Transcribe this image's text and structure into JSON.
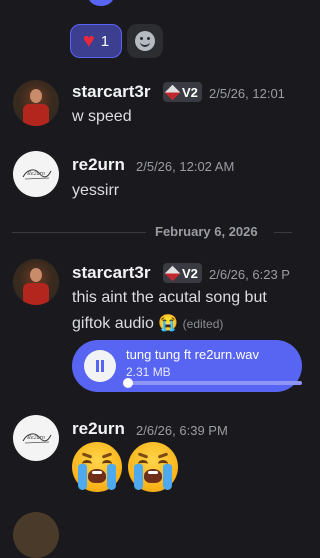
{
  "reactions": [
    {
      "emoji": "❤️",
      "icon": "heart-icon",
      "count": "1",
      "active": true
    },
    {
      "icon": "add-reaction-icon"
    }
  ],
  "messages": [
    {
      "user": "starcart3r",
      "badge": "V2",
      "timestamp": "2/5/26, 12:01",
      "text": "w speed"
    },
    {
      "user": "re2urn",
      "timestamp": "2/5/26, 12:02 AM",
      "text": "yessirr"
    },
    {
      "user": "starcart3r",
      "badge": "V2",
      "timestamp": "2/6/26, 6:23 P",
      "text_line1": "this aint the acutal song but",
      "text_line2": "giftok audio",
      "edited": "(edited)"
    },
    {
      "user": "re2urn",
      "timestamp": "2/6/26, 6:39 PM"
    }
  ],
  "date_divider": "February 6, 2026",
  "attachment": {
    "filename": "tung tung ft re2urn.wav",
    "size": "2.31 MB",
    "progress": 0
  },
  "avatar_logo_text": "Re2urn",
  "colors": {
    "background": "#1a1a1e",
    "accent": "#5865f2",
    "username": "#f2f3f5",
    "timestamp": "#9a9ca3"
  }
}
